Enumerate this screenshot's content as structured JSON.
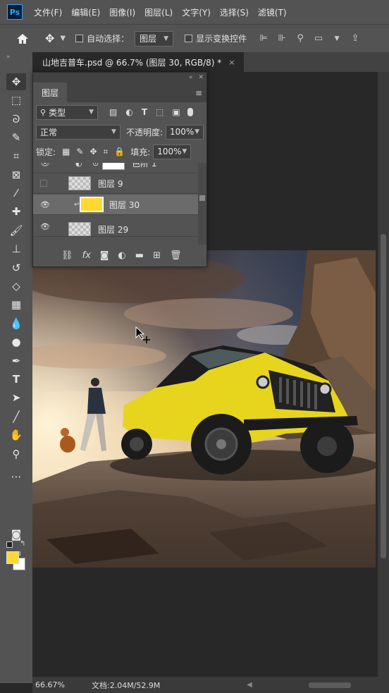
{
  "app": {
    "logo": "Ps"
  },
  "menu": [
    "文件(F)",
    "编辑(E)",
    "图像(I)",
    "图层(L)",
    "文字(Y)",
    "选择(S)",
    "滤镜(T)"
  ],
  "options": {
    "auto_select_label": "自动选择：",
    "auto_select_value": "图层",
    "show_transform_label": "显示变换控件"
  },
  "document_tab": {
    "title": "山地吉普车.psd @ 66.7% (图层 30, RGB/8) *",
    "close": "×"
  },
  "layers_panel": {
    "tab_label": "图层",
    "filter_type": "类型",
    "blend_mode": "正常",
    "opacity_label": "不透明度:",
    "opacity_value": "100%",
    "lock_label": "锁定:",
    "fill_label": "填充:",
    "fill_value": "100%",
    "layers": [
      {
        "name": "色阶 1",
        "visible": true,
        "type": "adjustment"
      },
      {
        "name": "图层 9",
        "visible": false,
        "type": "pixel"
      },
      {
        "name": "图层 30",
        "visible": true,
        "type": "fill",
        "selected": true,
        "clipped": true,
        "thumb_color": "#ffd92f"
      },
      {
        "name": "图层 29",
        "visible": true,
        "type": "pixel"
      }
    ]
  },
  "colors": {
    "foreground": "#ffd92f",
    "background": "#ffffff",
    "accent": "#31a8ff"
  },
  "status": {
    "zoom": "66.67%",
    "doc_info": "文档:2.04M/52.9M"
  }
}
